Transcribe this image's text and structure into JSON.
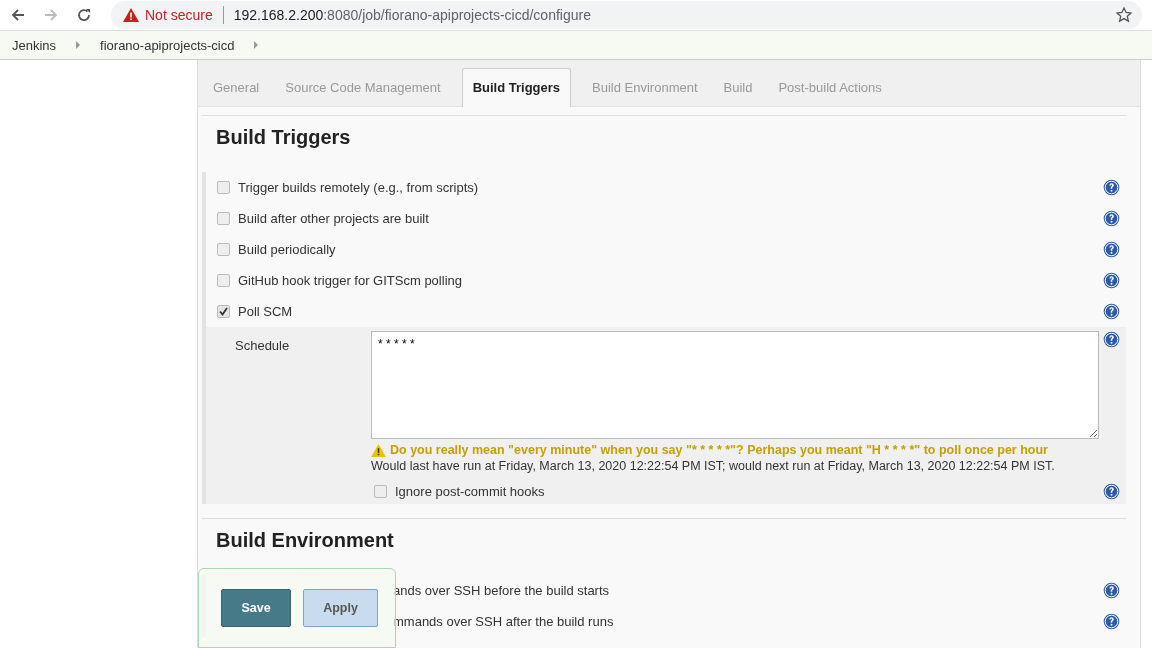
{
  "browser": {
    "security": "Not secure",
    "url_host": "192.168.2.200",
    "url_rest": ":8080/job/fiorano-apiprojects-cicd/configure"
  },
  "breadcrumbs": [
    "Jenkins",
    "fiorano-apiprojects-cicd"
  ],
  "tabs": [
    {
      "label": "General",
      "selected": false
    },
    {
      "label": "Source Code Management",
      "selected": false
    },
    {
      "label": "Build Triggers",
      "selected": true
    },
    {
      "label": "Build Environment",
      "selected": false
    },
    {
      "label": "Build",
      "selected": false
    },
    {
      "label": "Post-build Actions",
      "selected": false
    }
  ],
  "build_triggers": {
    "title": "Build Triggers",
    "options": [
      {
        "label": "Trigger builds remotely (e.g., from scripts)",
        "checked": false
      },
      {
        "label": "Build after other projects are built",
        "checked": false
      },
      {
        "label": "Build periodically",
        "checked": false
      },
      {
        "label": "GitHub hook trigger for GITScm polling",
        "checked": false
      },
      {
        "label": "Poll SCM",
        "checked": true
      }
    ],
    "schedule": {
      "label": "Schedule",
      "value": "* * * * *",
      "warning": "Do you really mean \"every minute\" when you say \"* * * * *\"? Perhaps you meant \"H * * * *\" to poll once per hour",
      "info": "Would last have run at Friday, March 13, 2020 12:22:54 PM IST; would next run at Friday, March 13, 2020 12:22:54 PM IST.",
      "ignore_hooks": {
        "label": "Ignore post-commit hooks",
        "checked": false
      }
    }
  },
  "build_environment": {
    "title": "Build Environment",
    "options": [
      {
        "label": "ands over SSH before the build starts"
      },
      {
        "label": "mmands over SSH after the build runs"
      }
    ]
  },
  "buttons": [
    {
      "label": "Save",
      "kind": "primary"
    },
    {
      "label": "Apply",
      "kind": "secondary"
    }
  ]
}
